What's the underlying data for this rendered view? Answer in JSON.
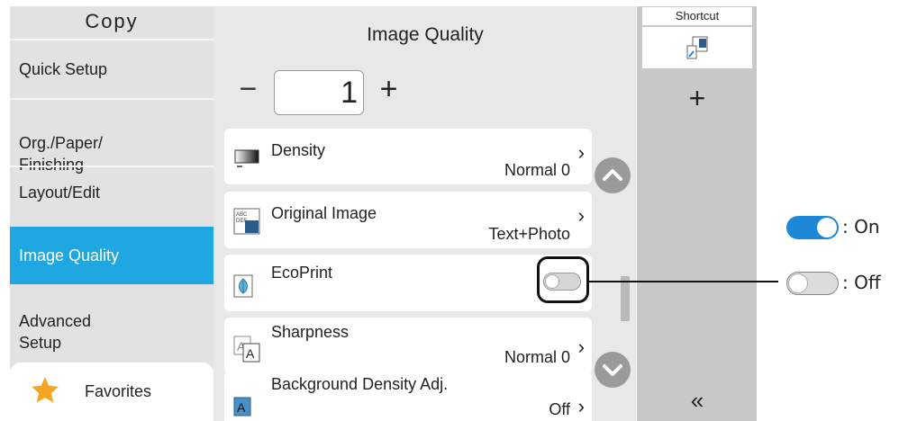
{
  "sidebar": {
    "title": "Copy",
    "items": [
      {
        "label": "Quick Setup"
      },
      {
        "label": "Org./Paper/\nFinishing"
      },
      {
        "label": "Layout/Edit"
      },
      {
        "label": "Image Quality",
        "active": true
      },
      {
        "label": "Advanced\nSetup"
      }
    ],
    "favorites_label": "Favorites"
  },
  "main": {
    "title": "Image Quality",
    "copies": "1",
    "rows": [
      {
        "label": "Density",
        "value": "Normal 0"
      },
      {
        "label": "Original Image",
        "value": "Text+Photo"
      },
      {
        "label": "EcoPrint",
        "toggle": "off"
      },
      {
        "label": "Sharpness",
        "value": "Normal 0"
      },
      {
        "label": "Background Density Adj.",
        "value": "Off"
      }
    ]
  },
  "rightstrip": {
    "shortcut_label": "Shortcut",
    "add_label": "+",
    "collapse_label": "«"
  },
  "legend": {
    "on_label": ": On",
    "off_label": ": Off"
  },
  "colors": {
    "accent": "#1ea7e1",
    "toggle_on": "#1e88d8",
    "favorite_star": "#f5a623"
  }
}
